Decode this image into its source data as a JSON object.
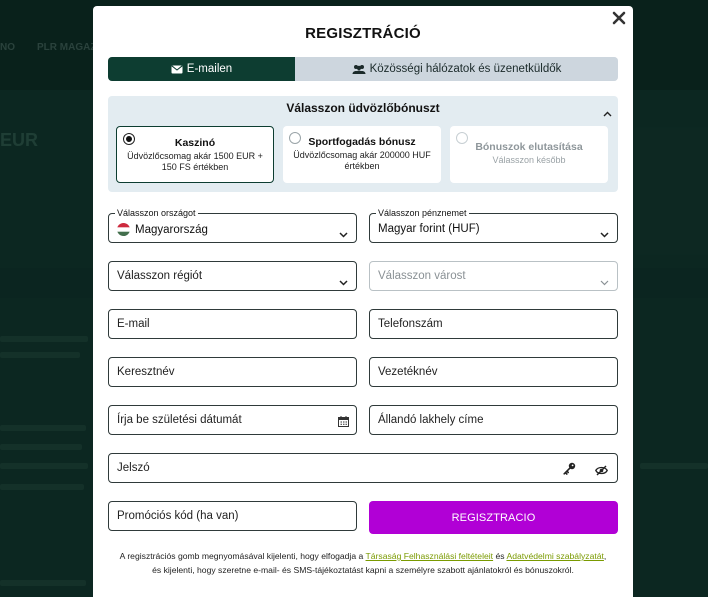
{
  "background": {
    "nav": [
      "NO",
      "PLR MAGAZI"
    ],
    "hero": "EUR",
    "text_color": "#3f5d55"
  },
  "modal": {
    "title": "REGISZTRÁCIÓ",
    "close_icon": "close-icon"
  },
  "tabs": [
    {
      "label": "E-mailen",
      "icon": "envelope-icon",
      "active": true
    },
    {
      "label": "Közösségi hálózatok és üzenetküldők",
      "icon": "users-icon",
      "active": false
    }
  ],
  "bonus": {
    "heading": "Válasszon üdvözlőbónuszt",
    "options": [
      {
        "title": "Kaszinó",
        "subtitle": "Üdvözlőcsomag akár 1500 EUR + 150 FS értékben",
        "selected": true
      },
      {
        "title": "Sportfogadás bónusz",
        "subtitle": "Üdvözlőcsomag akár 200000 HUF értékben",
        "selected": false
      },
      {
        "title": "Bónuszok elutasítása",
        "subtitle": "Válasszon később",
        "selected": false
      }
    ]
  },
  "form": {
    "country": {
      "label": "Válasszon országot",
      "value": "Magyarország",
      "flag": "hungary-flag"
    },
    "currency": {
      "label": "Válasszon pénznemet",
      "value": "Magyar forint (HUF)"
    },
    "region": {
      "placeholder": "Válasszon régiót"
    },
    "city": {
      "placeholder": "Válasszon várost"
    },
    "email": {
      "placeholder": "E-mail"
    },
    "phone": {
      "placeholder": "Telefonszám"
    },
    "first_name": {
      "placeholder": "Keresztnév"
    },
    "last_name": {
      "placeholder": "Vezetéknév"
    },
    "birthdate": {
      "placeholder": "Írja be születési dátumát"
    },
    "address": {
      "placeholder": "Állandó lakhely címe"
    },
    "password": {
      "placeholder": "Jelszó"
    },
    "promo": {
      "placeholder": "Promóciós kód (ha van)"
    },
    "submit_label": "REGISZTRACIO"
  },
  "legal": {
    "part1": "A regisztrációs gomb megnyomásával kijelenti, hogy elfogadja a ",
    "link1": "Társaság Felhasználási feltételeit",
    "part2": " és ",
    "link2": "Adatvédelmi szabályzatát",
    "part3": ",",
    "line2": "és kijelenti, hogy szeretne e-mail- és SMS-tájékoztatást kapni a személyre szabott ajánlatokról és bónuszokról."
  },
  "colors": {
    "primary_dark": "#0d3d31",
    "accent": "#b100d6",
    "link": "#7a9a00"
  }
}
